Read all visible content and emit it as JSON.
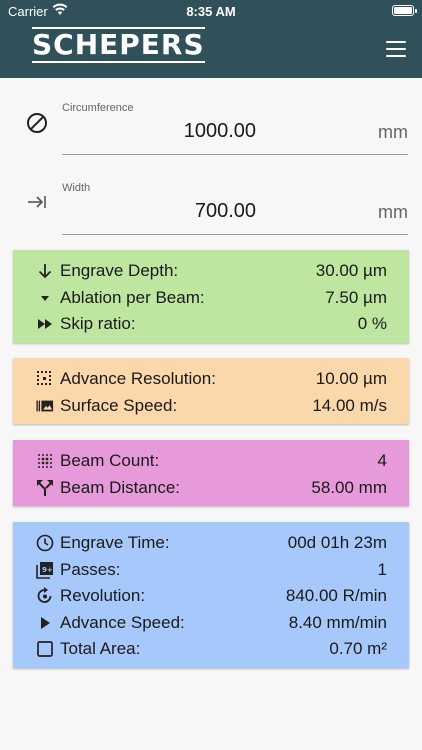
{
  "status": {
    "carrier": "Carrier",
    "time": "8:35 AM"
  },
  "appbar": {
    "logo": "SCHEPERS",
    "menu_icon": "hamburger-menu-icon"
  },
  "inputs": [
    {
      "label": "Circumference",
      "value": "1000.00",
      "unit": "mm",
      "icon": "diameter-icon"
    },
    {
      "label": "Width",
      "value": "700.00",
      "unit": "mm",
      "icon": "arrow-to-end-icon"
    }
  ],
  "cards": [
    {
      "color": "#bfe6a1",
      "rows": [
        {
          "label": "Engrave Depth:",
          "value": "30.00 µm",
          "icon": "arrow-down-icon"
        },
        {
          "label": "Ablation per Beam:",
          "value": "7.50 µm",
          "icon": "caret-down-icon"
        },
        {
          "label": "Skip ratio:",
          "value": "0 %",
          "icon": "fast-forward-icon"
        }
      ]
    },
    {
      "color": "#fbd8ab",
      "rows": [
        {
          "label": "Advance Resolution:",
          "value": "10.00 µm",
          "icon": "dotted-grid-icon"
        },
        {
          "label": "Surface Speed:",
          "value": "14.00 m/s",
          "icon": "image-motion-icon"
        }
      ]
    },
    {
      "color": "#e79ad9",
      "rows": [
        {
          "label": "Beam Count:",
          "value": "4",
          "icon": "dots-grid-icon"
        },
        {
          "label": "Beam Distance:",
          "value": "58.00 mm",
          "icon": "split-arrows-icon"
        }
      ]
    },
    {
      "color": "#a7c8fb",
      "rows": [
        {
          "label": "Engrave Time:",
          "value": "00d 01h 23m",
          "icon": "clock-icon"
        },
        {
          "label": "Passes:",
          "value": "1",
          "icon": "filter-9-plus-icon"
        },
        {
          "label": "Revolution:",
          "value": "840.00 R/min",
          "icon": "rotate-icon"
        },
        {
          "label": "Advance Speed:",
          "value": "8.40 mm/min",
          "icon": "play-icon"
        },
        {
          "label": "Total Area:",
          "value": "0.70 m²",
          "icon": "square-outline-icon"
        }
      ]
    }
  ]
}
